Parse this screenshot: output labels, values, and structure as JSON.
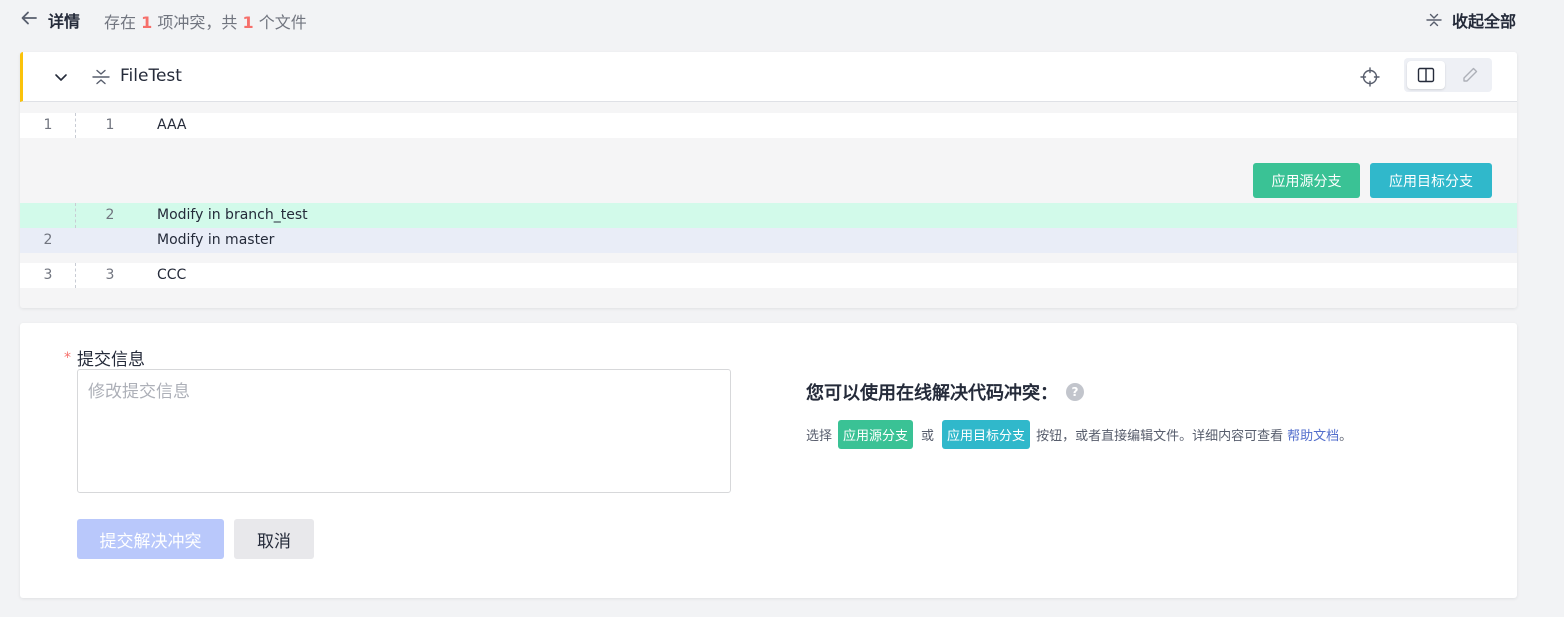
{
  "header": {
    "title": "详情",
    "summary_prefix": "存在",
    "conflict_count": "1",
    "summary_middle": "项冲突，共",
    "file_count": "1",
    "summary_suffix": "个文件",
    "collapse_all": "收起全部"
  },
  "file": {
    "name": "FileTest",
    "apply_source": "应用源分支",
    "apply_target": "应用目标分支",
    "lines": [
      {
        "left": "1",
        "right": "1",
        "text": "AAA"
      },
      {
        "left": "",
        "right": "2",
        "text": "Modify in branch_test"
      },
      {
        "left": "2",
        "right": "",
        "text": "Modify in master"
      },
      {
        "left": "3",
        "right": "3",
        "text": "CCC"
      }
    ]
  },
  "commit": {
    "required_mark": "*",
    "label": "提交信息",
    "placeholder": "修改提交信息",
    "submit_label": "提交解决冲突",
    "cancel_label": "取消"
  },
  "tip": {
    "title": "您可以使用在线解决代码冲突：",
    "help_icon": "?",
    "select_text": "选择",
    "source_tag": "应用源分支",
    "or_text": "或",
    "target_tag": "应用目标分支",
    "rest_text": "按钮，或者直接编辑文件。详细内容可查看",
    "link_text": "帮助文档",
    "end_text": "。"
  },
  "colors": {
    "accent_source": "#3ac295",
    "accent_target": "#30b8cb",
    "highlight": "#f66f6a",
    "file_marker": "#fac20a"
  }
}
